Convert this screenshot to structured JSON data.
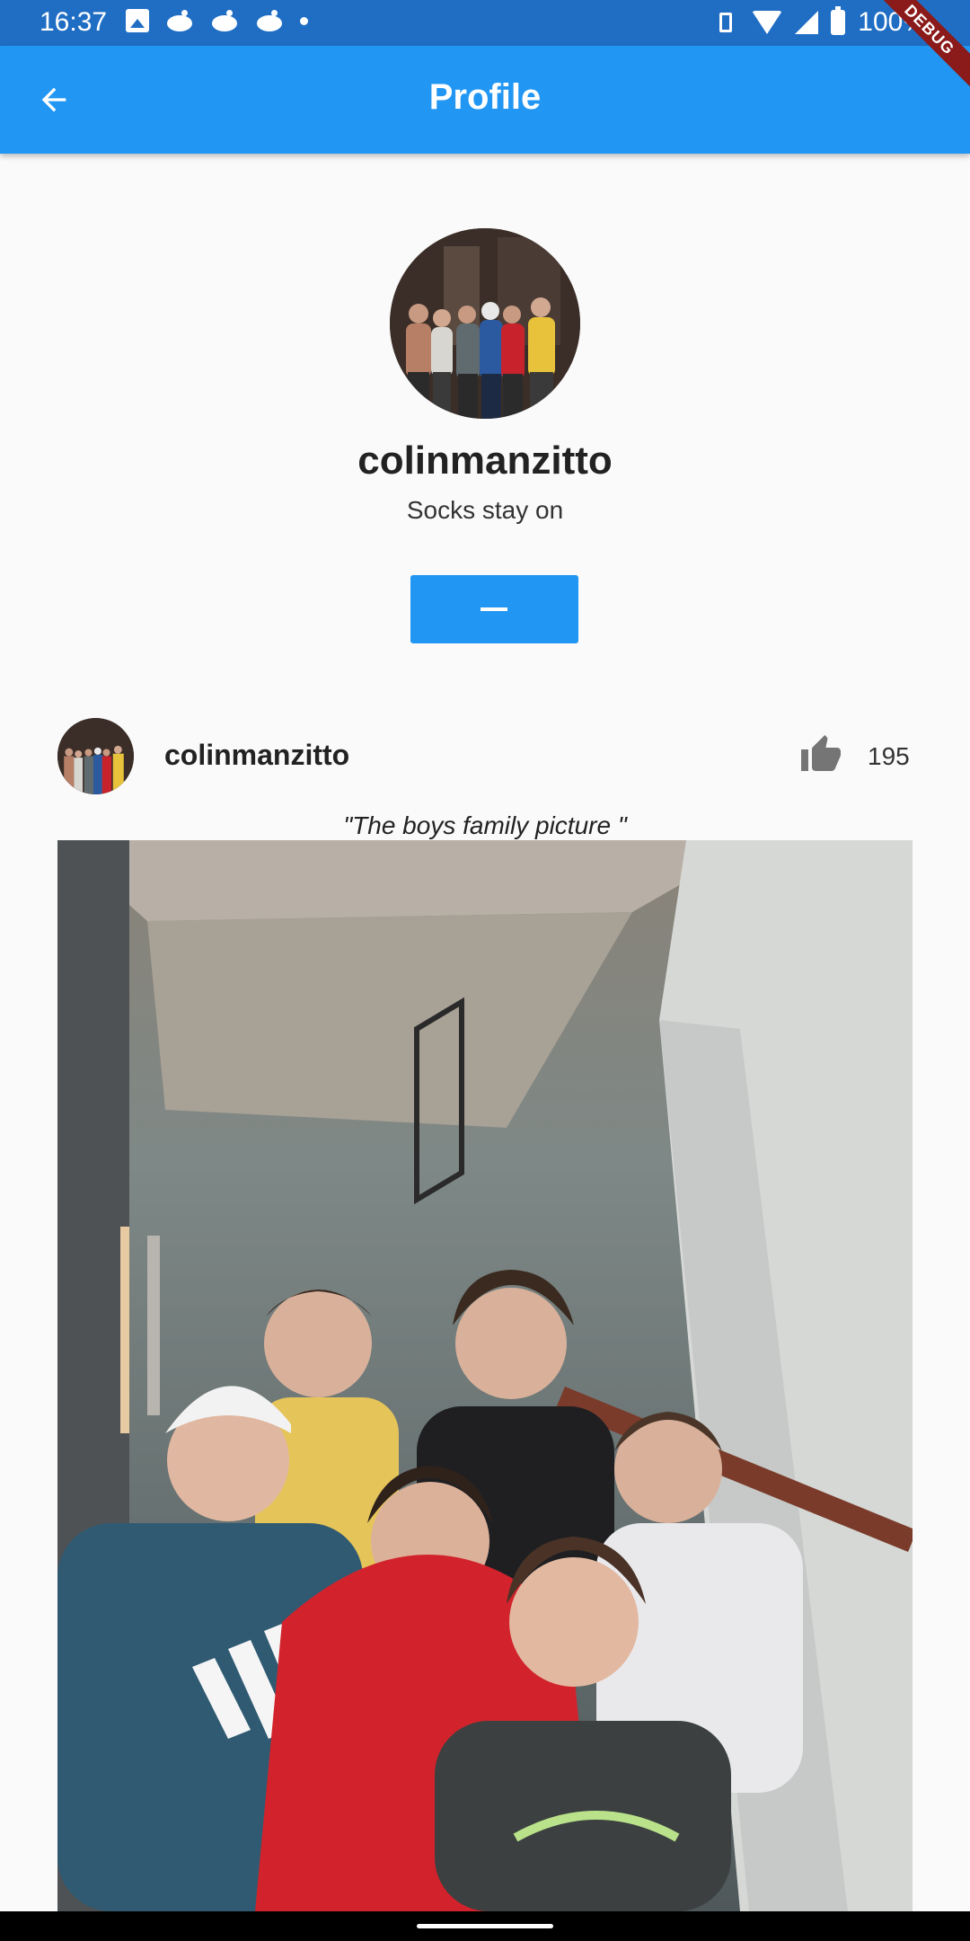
{
  "status_bar": {
    "time": "16:37",
    "battery": "100%"
  },
  "debug_banner": "DEBUG",
  "app_bar": {
    "title": "Profile"
  },
  "profile": {
    "username": "colinmanzitto",
    "bio": "Socks stay on",
    "follow_button_symbol": "—"
  },
  "post": {
    "username": "colinmanzitto",
    "likes": "195",
    "caption": "\"The boys family picture \""
  },
  "colors": {
    "app_bar": "#2196f3",
    "status_bar": "#1f6ec4",
    "background": "#fafafa",
    "button": "#2196f3"
  }
}
